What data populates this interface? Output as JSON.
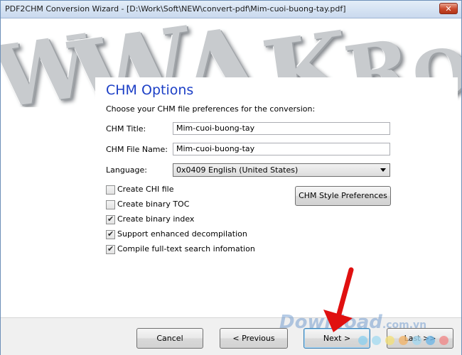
{
  "window": {
    "title": "PDF2CHM Conversion Wizard - [D:\\Work\\Soft\\NEW\\convert-pdf\\Mim-cuoi-buong-tay.pdf]",
    "close_glyph": "✕"
  },
  "page": {
    "heading": "CHM Options",
    "subtitle": "Choose your CHM file preferences for the conversion:"
  },
  "form": {
    "chm_title_label": "CHM Title:",
    "chm_title_value": "Mim-cuoi-buong-tay",
    "chm_file_label": "CHM File Name:",
    "chm_file_value": "Mim-cuoi-buong-tay",
    "language_label": "Language:",
    "language_value": "0x0409 English (United States)"
  },
  "options": [
    {
      "label": "Create CHI file",
      "checked": false
    },
    {
      "label": "Create binary TOC",
      "checked": false
    },
    {
      "label": "Create binary index",
      "checked": true
    },
    {
      "label": "Support enhanced decompilation",
      "checked": true
    },
    {
      "label": "Compile full-text search infomation",
      "checked": true
    }
  ],
  "buttons": {
    "style_prefs": "CHM Style Preferences",
    "cancel": "Cancel",
    "previous": "< Previous",
    "next": "Next >",
    "last": "Last >>"
  },
  "watermark": {
    "text": "Download",
    "suffix": ".com.vn"
  },
  "colors": {
    "heading": "#1c3fc6",
    "arrow": "#e01010"
  }
}
